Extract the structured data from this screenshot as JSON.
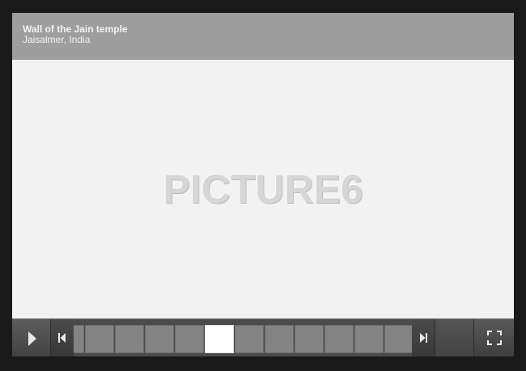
{
  "caption": {
    "title": "Wall of the Jain temple",
    "subtitle": "Jaisalmer, India"
  },
  "stage": {
    "watermark": "PICTURE6"
  },
  "controls": {
    "play_icon": "play-icon",
    "prev_icon": "skip-previous-icon",
    "next_icon": "skip-next-icon",
    "fullscreen_icon": "fullscreen-icon"
  },
  "thumbnails": {
    "count": 12,
    "active_index": 5
  },
  "colors": {
    "background": "#1a1a1a",
    "caption_bar": "#9e9e9e",
    "stage": "#f2f2f2",
    "controlbar": "#4a4a4a",
    "thumb": "#838383",
    "thumb_active": "#ffffff"
  }
}
